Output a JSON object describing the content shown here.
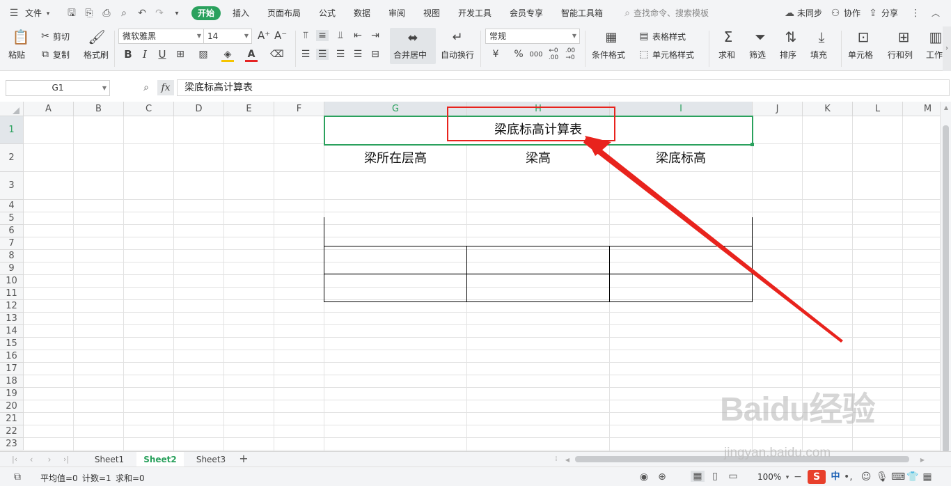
{
  "menubar": {
    "file": "文件",
    "tabs": [
      "开始",
      "插入",
      "页面布局",
      "公式",
      "数据",
      "审阅",
      "视图",
      "开发工具",
      "会员专享",
      "智能工具箱"
    ],
    "search_placeholder": "查找命令、搜索模板",
    "sync": "未同步",
    "collab": "协作",
    "share": "分享"
  },
  "ribbon": {
    "paste": "粘贴",
    "cut": "剪切",
    "copy": "复制",
    "format_painter": "格式刷",
    "font_name": "微软雅黑",
    "font_size": "14",
    "bold": "B",
    "italic": "I",
    "underline": "U",
    "merge_center": "合并居中",
    "wrap_text": "自动换行",
    "number_format": "常规",
    "currency": "¥",
    "percent": "%",
    "thousands": "000",
    "inc_decimal": "←0 .00",
    "dec_decimal": ".00 →0",
    "cond_format": "条件格式",
    "table_style": "表格样式",
    "cell_style": "单元格样式",
    "sum": "求和",
    "filter": "筛选",
    "sort": "排序",
    "fill": "填充",
    "cell": "单元格",
    "row_col": "行和列",
    "worksheet": "工作"
  },
  "formula_bar": {
    "name_box": "G1",
    "fx": "fx",
    "content": "梁底标高计算表"
  },
  "sheet": {
    "columns": [
      "A",
      "B",
      "C",
      "D",
      "E",
      "F",
      "G",
      "H",
      "I",
      "J",
      "K",
      "L",
      "M"
    ],
    "rows": [
      "1",
      "2",
      "3",
      "4",
      "5",
      "6",
      "7",
      "8",
      "9",
      "10",
      "11",
      "12",
      "13",
      "14",
      "15",
      "16",
      "17",
      "18",
      "19",
      "20",
      "21",
      "22",
      "23"
    ],
    "title": "梁底标高计算表",
    "headers": [
      "梁所在层高",
      "梁高",
      "梁底标高"
    ]
  },
  "sheet_tabs": [
    "Sheet1",
    "Sheet2",
    "Sheet3"
  ],
  "status": {
    "average": "平均值=0",
    "count": "计数=1",
    "sum": "求和=0",
    "zoom": "100%"
  },
  "watermark": {
    "brand": "Baidu经验",
    "url": "jingyan.baidu.com"
  },
  "colors": {
    "accent": "#2aa15d",
    "annotation": "#e8231d"
  }
}
